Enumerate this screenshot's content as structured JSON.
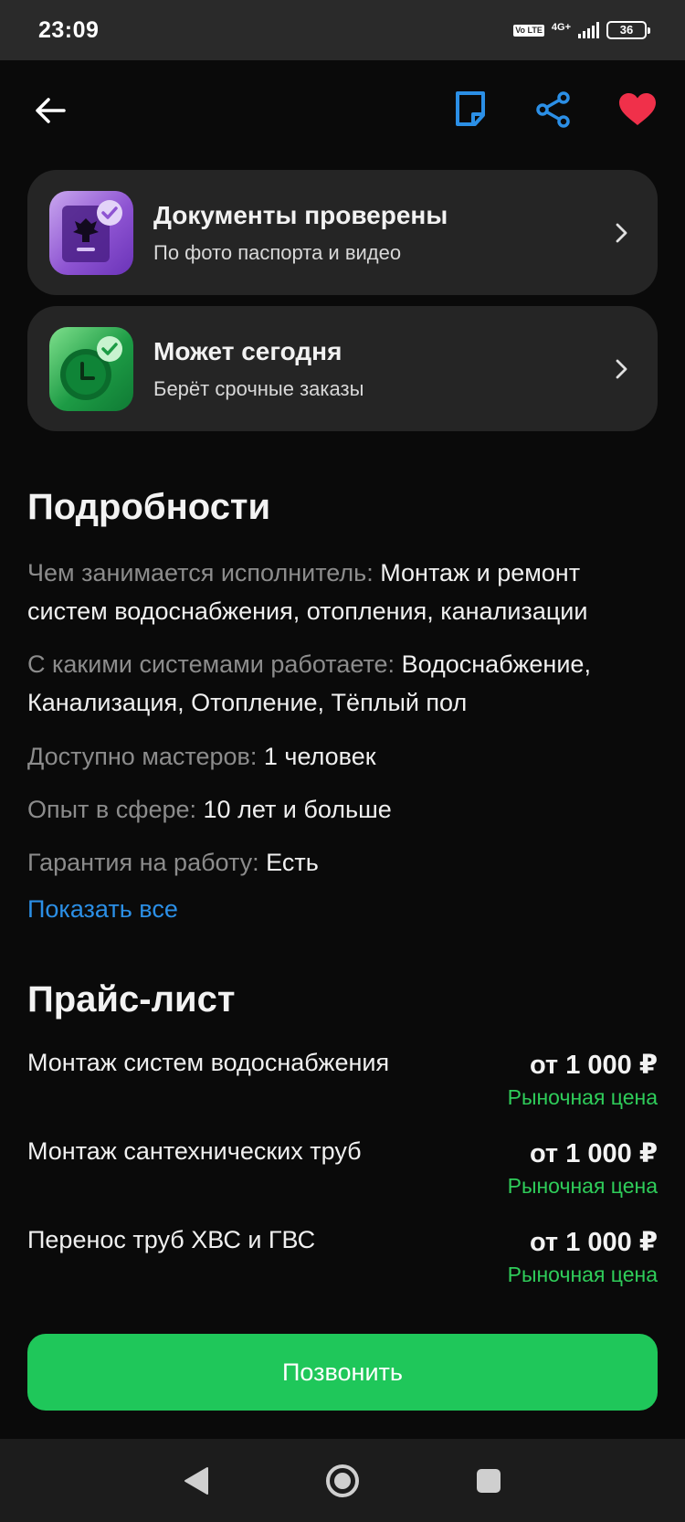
{
  "status_bar": {
    "time": "23:09",
    "volte": "Vo LTE",
    "network": "4G+",
    "battery": "36"
  },
  "header": {
    "back_icon": "arrow-left-icon",
    "note_icon": "note-icon",
    "share_icon": "share-icon",
    "favorite_icon": "heart-icon",
    "accent_color": "#2b8fe6",
    "favorite_color": "#f0304a"
  },
  "cards": [
    {
      "title": "Документы проверены",
      "subtitle": "По фото паспорта и видео",
      "icon": "passport-check-icon"
    },
    {
      "title": "Может сегодня",
      "subtitle": "Берёт срочные заказы",
      "icon": "clock-check-icon"
    }
  ],
  "details": {
    "title": "Подробности",
    "items": [
      {
        "label": "Чем занимается исполнитель:",
        "value": "Монтаж и ремонт систем водоснабжения, отопления, канализации"
      },
      {
        "label": "С какими системами работаете:",
        "value": "Водоснабжение, Канализация, Отопление, Тёплый пол"
      },
      {
        "label": "Доступно мастеров:",
        "value": "1 человек"
      },
      {
        "label": "Опыт в сфере:",
        "value": "10 лет и больше"
      },
      {
        "label": "Гарантия на работу:",
        "value": "Есть"
      }
    ],
    "show_all": "Показать все"
  },
  "price_list": {
    "title": "Прайс-лист",
    "items": [
      {
        "name": "Монтаж систем водоснабжения",
        "price": "от 1 000 ₽",
        "note": "Рыночная цена"
      },
      {
        "name": "Монтаж сантехнических труб",
        "price": "от 1 000 ₽",
        "note": "Рыночная цена"
      },
      {
        "name": "Перенос труб ХВС и ГВС",
        "price": "от 1 000 ₽",
        "note": "Рыночная цена"
      }
    ]
  },
  "call_button": "Позвонить",
  "colors": {
    "primary_green": "#1fc75a",
    "price_note_green": "#2fcd5a",
    "card_bg": "#252525"
  },
  "nav": {
    "back": "nav-back-icon",
    "home": "nav-home-icon",
    "recents": "nav-recents-icon"
  }
}
